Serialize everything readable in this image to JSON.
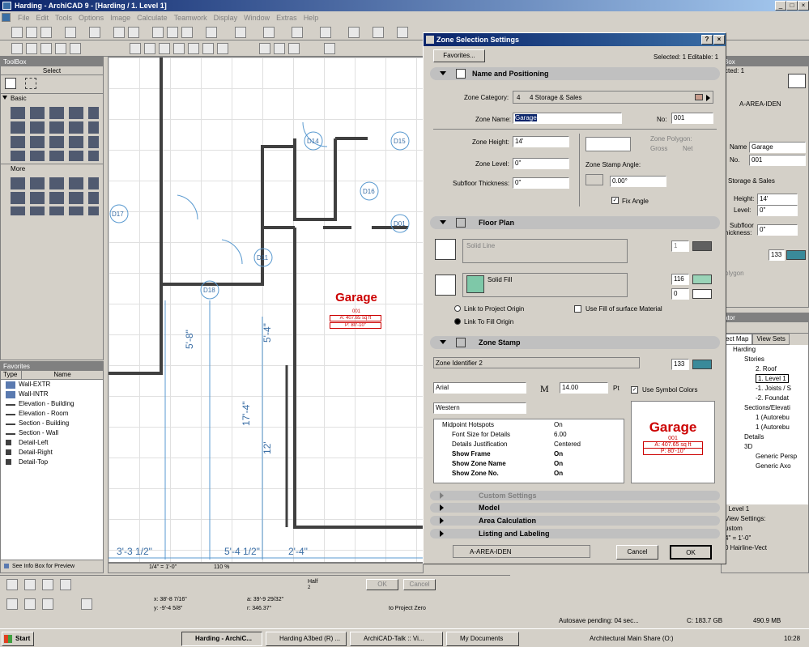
{
  "window": {
    "title": "Harding - ArchiCAD 9 - [Harding / 1. Level 1]"
  },
  "menu": [
    "File",
    "Edit",
    "Tools",
    "Options",
    "Image",
    "Calculate",
    "Teamwork",
    "Display",
    "Window",
    "Extras",
    "Help"
  ],
  "toolbox": {
    "title": "ToolBox",
    "select_label": "Select",
    "basic_label": "Basic",
    "more_label": "More"
  },
  "favorites": {
    "title": "Favorites",
    "col_type": "Type",
    "col_name": "Name",
    "items": [
      "Wall-EXTR",
      "Wall-INTR",
      "Elevation - Building",
      "Elevation - Room",
      "Section - Building",
      "Section - Wall",
      "Detail-Left",
      "Detail-Right",
      "Detail-Top"
    ],
    "footer": "See Info Box for Preview"
  },
  "plan": {
    "zone_name": "Garage",
    "zone_no": "001",
    "zone_area": "A: 407.65 sq ft",
    "zone_perim": "P: 80'-10\"",
    "door_tags": [
      "D14",
      "D15",
      "D16",
      "D17",
      "D11",
      "D18",
      "D01"
    ],
    "dims": [
      "5'-8\"",
      "5'-4\"",
      "17'-4\"",
      "12'",
      "3'-3 1/2\"",
      "5'-4 1/2\"",
      "2'-4\""
    ]
  },
  "status": {
    "scale": "1/4\" = 1'-0\"",
    "zoom": "110 %",
    "x": "x: 38'-8 7/16\"",
    "y": "y: -9'-4 5/8\"",
    "a": "a: 39'-9 29/32\"",
    "r": "r: 346.37°",
    "to_project_zero": "to Project Zero",
    "half": "Half",
    "half_num": "2",
    "ok": "OK",
    "cancel": "Cancel",
    "autosave": "Autosave pending: 04 sec...",
    "disk_c": "C: 183.7 GB",
    "mem": "490.9 MB"
  },
  "dialog": {
    "title": "Zone Selection Settings",
    "favorites_btn": "Favorites...",
    "selected_info": "Selected: 1 Editable: 1",
    "sec_name": "Name and Positioning",
    "zone_category_label": "Zone Category:",
    "zone_category_num": "4",
    "zone_category_value": "4 Storage & Sales",
    "zone_name_label": "Zone Name:",
    "zone_name_value": "Garage",
    "no_label": "No:",
    "no_value": "001",
    "zone_height_label": "Zone Height:",
    "zone_height_value": "14'",
    "zone_level_label": "Zone Level:",
    "zone_level_value": "0\"",
    "subfloor_label": "Subfloor Thickness:",
    "subfloor_value": "0\"",
    "zone_polygon_label": "Zone Polygon:",
    "gross": "Gross",
    "net": "Net",
    "stamp_angle_label": "Zone Stamp Angle:",
    "stamp_angle_value": "0.00°",
    "fix_angle": "Fix Angle",
    "sec_floor": "Floor Plan",
    "solid_line": "Solid Line",
    "pen1": "1",
    "solid_fill": "Solid Fill",
    "pen116": "116",
    "pen0": "0",
    "link_project": "Link to Project Origin",
    "link_fill": "Link To Fill Origin",
    "use_fill_surface": "Use Fill of surface Material",
    "sec_stamp": "Zone Stamp",
    "zone_identifier": "Zone Identifier 2",
    "pen133": "133",
    "font": "Arial",
    "font_size": "14.00",
    "pt": "Pt",
    "use_symbol_colors": "Use Symbol Colors",
    "script": "Western",
    "params": [
      {
        "name": "Midpoint Hotspots",
        "value": "On",
        "bold": false
      },
      {
        "name": "Font Size for Details",
        "value": "6.00",
        "bold": false
      },
      {
        "name": "Details Justification",
        "value": "Centered",
        "bold": false
      },
      {
        "name": "Show Frame",
        "value": "On",
        "bold": true
      },
      {
        "name": "Show Zone Name",
        "value": "On",
        "bold": true
      },
      {
        "name": "Show Zone No.",
        "value": "On",
        "bold": true
      }
    ],
    "preview_name": "Garage",
    "preview_no": "001",
    "preview_area": "A: 407.65 sq ft",
    "preview_perim": "P: 80'-10\"",
    "sec_custom": "Custom Settings",
    "sec_model": "Model",
    "sec_area": "Area Calculation",
    "sec_listing": "Listing and Labeling",
    "layer": "A-AREA-IDEN",
    "cancel": "Cancel",
    "ok": "OK"
  },
  "infobox": {
    "selected": "cted: 1",
    "layer": "A-AREA-IDEN",
    "name_label": "Name",
    "name_value": "Garage",
    "no_label": "No.",
    "no_value": "001",
    "category": "Storage & Sales",
    "height_label": "Height:",
    "height_value": "14'",
    "level_label": "Level:",
    "level_value": "0\"",
    "subfloor": "Subfloor",
    "thickness": "hickness:",
    "subfloor_value": "0\"",
    "pen": "133",
    "polygon": "olygon"
  },
  "navigator": {
    "title": "ator",
    "tab1": "ect Map",
    "tab2": "View Sets",
    "tree": [
      "Harding",
      "Stories",
      "2. Roof",
      "1. Level 1",
      "-1. Joists / S",
      "-2. Foundat",
      "Sections/Elevati",
      "1 (Autorebu",
      "1 (Autorebu",
      "Details",
      "3D",
      "Generic Persp",
      "Generic Axo"
    ],
    "level": ". Level 1",
    "view_settings": "View Settings:",
    "custom": "ustom",
    "scale": "4\" = 1'-0\"",
    "pen_set": "0 Hairline-Vect"
  },
  "taskbar": {
    "start": "Start",
    "tasks": [
      "Harding - ArchiC...",
      "Harding A3bed (R) ...",
      "ArchiCAD-Talk :: Vi...",
      "My Documents"
    ],
    "share": "Architectural Main Share (O:)",
    "clock": "10:28"
  },
  "colors": {
    "accent": "#0a246a",
    "fill_swatch": "#7ec8a8",
    "zone_red": "#cc0000",
    "wall": "#404040"
  }
}
